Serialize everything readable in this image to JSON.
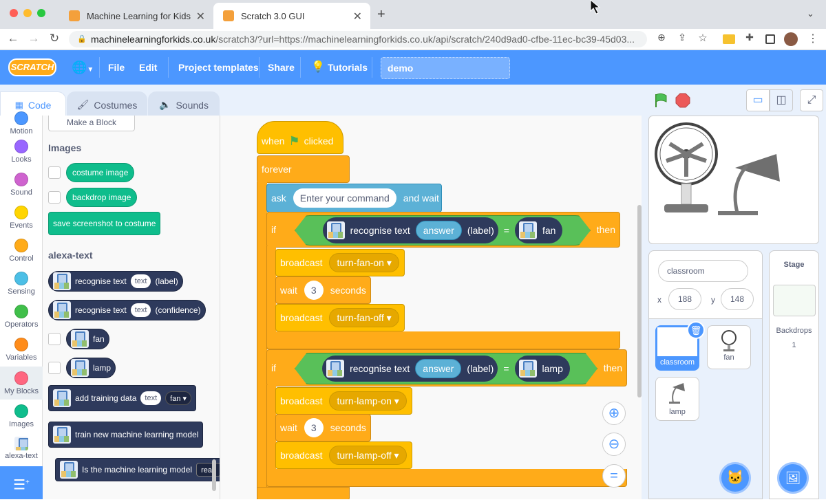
{
  "browser": {
    "tabs": [
      {
        "title": "Machine Learning for Kids"
      },
      {
        "title": "Scratch 3.0 GUI"
      }
    ],
    "url_host": "machinelearningforkids.co.uk",
    "url_path": "/scratch3/?url=https://machinelearningforkids.co.uk/api/scratch/240d9ad0-cfbe-11ec-bc39-45d03..."
  },
  "menu": {
    "logo": "SCRATCH",
    "file": "File",
    "edit": "Edit",
    "templates": "Project templates",
    "share": "Share",
    "tutorials": "Tutorials",
    "project_title": "demo"
  },
  "editor_tabs": {
    "code": "Code",
    "costumes": "Costumes",
    "sounds": "Sounds"
  },
  "categories": [
    {
      "label": "Motion",
      "color": "#4c97ff"
    },
    {
      "label": "Looks",
      "color": "#9966ff"
    },
    {
      "label": "Sound",
      "color": "#cf63cf"
    },
    {
      "label": "Events",
      "color": "#ffd500"
    },
    {
      "label": "Control",
      "color": "#ffab19"
    },
    {
      "label": "Sensing",
      "color": "#4cbfe6"
    },
    {
      "label": "Operators",
      "color": "#40bf4a"
    },
    {
      "label": "Variables",
      "color": "#ff8c1a"
    },
    {
      "label": "My Blocks",
      "color": "#ff6680"
    },
    {
      "label": "Images",
      "color": "#0fbd8c"
    },
    {
      "label": "alexa-text",
      "color": "#2e3a5c"
    }
  ],
  "palette": {
    "make_block": "Make a Block",
    "images_header": "Images",
    "costume_image": "costume image",
    "backdrop_image": "backdrop image",
    "save_screenshot": "save screenshot to costume",
    "alexa_header": "alexa-text",
    "recognise_label": {
      "a": "recognise text",
      "b": "text",
      "c": "(label)"
    },
    "recognise_conf": {
      "a": "recognise text",
      "b": "text",
      "c": "(confidence)"
    },
    "fan": "fan",
    "lamp": "lamp",
    "add_training": {
      "a": "add training data",
      "b": "text",
      "c": "fan"
    },
    "train_model": "train new machine learning model",
    "is_model": {
      "a": "Is the machine learning model",
      "b": "read"
    }
  },
  "script": {
    "when": "when",
    "clicked": "clicked",
    "forever": "forever",
    "ask": "ask",
    "ask_input": "Enter your command",
    "and_wait": "and wait",
    "if": "if",
    "then": "then",
    "recognise_text": "recognise text",
    "answer": "answer",
    "label": "(label)",
    "eq": "=",
    "fan": "fan",
    "lamp": "lamp",
    "broadcast": "broadcast",
    "wait": "wait",
    "seconds": "seconds",
    "wait_value": "3",
    "msg_fan_on": "turn-fan-on",
    "msg_fan_off": "turn-fan-off",
    "msg_lamp_on": "turn-lamp-on",
    "msg_lamp_off": "turn-lamp-off"
  },
  "sprite_info": {
    "name": "classroom",
    "x_label": "x",
    "x": "188",
    "y_label": "y",
    "y": "148"
  },
  "sprites": [
    {
      "name": "classroom"
    },
    {
      "name": "fan"
    },
    {
      "name": "lamp"
    }
  ],
  "stage_panel": {
    "title": "Stage",
    "backdrops_label": "Backdrops",
    "backdrops_count": "1"
  }
}
